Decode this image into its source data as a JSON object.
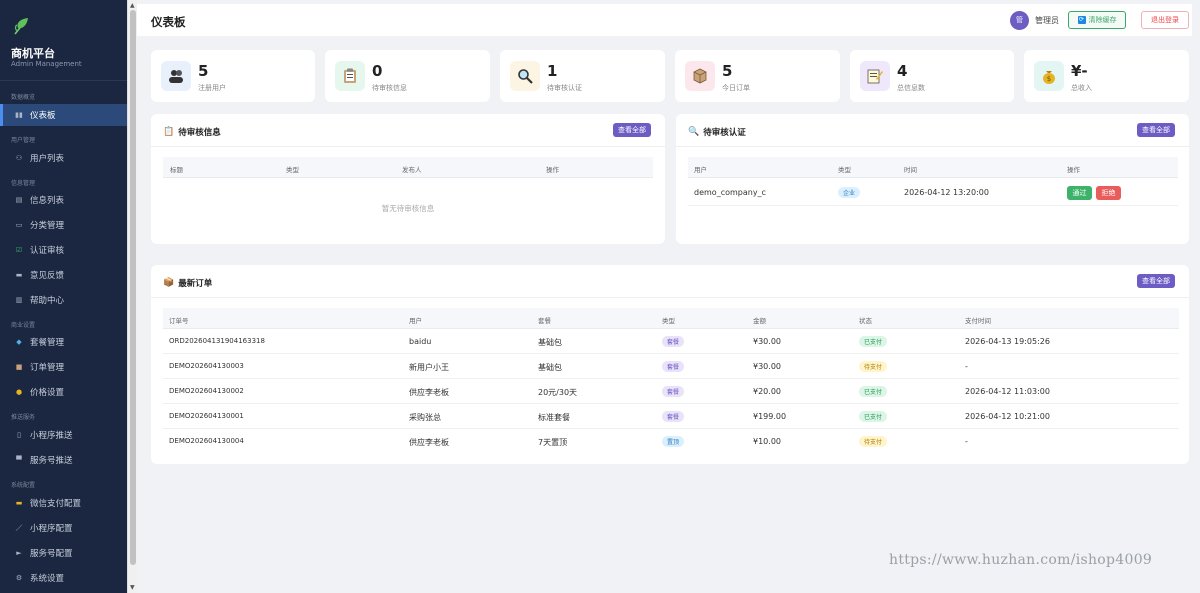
{
  "sidebar": {
    "brand": "商机平台",
    "brand_sub": "Admin Management",
    "groups": [
      "数据概览",
      "用户管理",
      "信息管理",
      "商业设置",
      "推送服务",
      "系统配置"
    ],
    "items": [
      {
        "label": "仪表板",
        "icon": "chart-icon"
      },
      {
        "label": "用户列表",
        "icon": "users-icon"
      },
      {
        "label": "信息列表",
        "icon": "document-icon"
      },
      {
        "label": "分类管理",
        "icon": "tag-icon"
      },
      {
        "label": "认证审核",
        "icon": "check-icon"
      },
      {
        "label": "意见反馈",
        "icon": "message-icon"
      },
      {
        "label": "帮助中心",
        "icon": "book-icon"
      },
      {
        "label": "套餐管理",
        "icon": "diamond-icon"
      },
      {
        "label": "订单管理",
        "icon": "box-icon"
      },
      {
        "label": "价格设置",
        "icon": "money-icon"
      },
      {
        "label": "小程序推送",
        "icon": "phone-icon"
      },
      {
        "label": "服务号推送",
        "icon": "mailbox-icon"
      },
      {
        "label": "微信支付配置",
        "icon": "card-icon"
      },
      {
        "label": "小程序配置",
        "icon": "pen-icon"
      },
      {
        "label": "服务号配置",
        "icon": "flag-icon"
      },
      {
        "label": "系统设置",
        "icon": "gear-icon"
      }
    ]
  },
  "header": {
    "title": "仪表板",
    "avatar_text": "管",
    "admin_label": "管理员",
    "clear_cache": "清除缓存",
    "logout": "退出登录"
  },
  "stats": [
    {
      "value": "5",
      "label": "注册用户",
      "icon": "users-icon",
      "bg": "#e8f0fc"
    },
    {
      "value": "0",
      "label": "待审核信息",
      "icon": "clipboard-icon",
      "bg": "#e6f7ee"
    },
    {
      "value": "1",
      "label": "待审核认证",
      "icon": "magnifier-icon",
      "bg": "#fdf5e3"
    },
    {
      "value": "5",
      "label": "今日订单",
      "icon": "box-icon",
      "bg": "#fce8ec"
    },
    {
      "value": "4",
      "label": "总信息数",
      "icon": "memo-icon",
      "bg": "#efe8fb"
    },
    {
      "value": "¥-",
      "label": "总收入",
      "icon": "money-bag-icon",
      "bg": "#e3f6f4"
    }
  ],
  "pending_info": {
    "title": "待审核信息",
    "view_all": "查看全部",
    "headers": [
      "标题",
      "类型",
      "发布人",
      "操作"
    ],
    "empty": "暂无待审核信息"
  },
  "pending_cert": {
    "title": "待审核认证",
    "view_all": "查看全部",
    "headers": [
      "用户",
      "类型",
      "时间",
      "操作"
    ],
    "rows": [
      {
        "user": "demo_company_c",
        "type": "企业",
        "time": "2026-04-12 13:20:00",
        "pass": "通过",
        "reject": "拒绝"
      }
    ]
  },
  "orders": {
    "title": "最新订单",
    "view_all": "查看全部",
    "headers": [
      "订单号",
      "用户",
      "套餐",
      "类型",
      "金额",
      "状态",
      "支付时间"
    ],
    "rows": [
      {
        "no": "ORD202604131904163318",
        "user": "baidu",
        "pkg": "基础包",
        "type": "套餐",
        "amount": "¥30.00",
        "status": "已支付",
        "paid": "2026-04-13 19:05:26"
      },
      {
        "no": "DEMO202604130003",
        "user": "新用户小王",
        "pkg": "基础包",
        "type": "套餐",
        "amount": "¥30.00",
        "status": "待支付",
        "paid": "-"
      },
      {
        "no": "DEMO202604130002",
        "user": "供应李老板",
        "pkg": "20元/30天",
        "type": "套餐",
        "amount": "¥20.00",
        "status": "已支付",
        "paid": "2026-04-12 11:03:00"
      },
      {
        "no": "DEMO202604130001",
        "user": "采购张总",
        "pkg": "标准套餐",
        "type": "套餐",
        "amount": "¥199.00",
        "status": "已支付",
        "paid": "2026-04-12 10:21:00"
      },
      {
        "no": "DEMO202604130004",
        "user": "供应李老板",
        "pkg": "7天置顶",
        "type": "置顶",
        "amount": "¥10.00",
        "status": "待支付",
        "paid": "-"
      }
    ]
  },
  "watermark": "https://www.huzhan.com/ishop4009"
}
